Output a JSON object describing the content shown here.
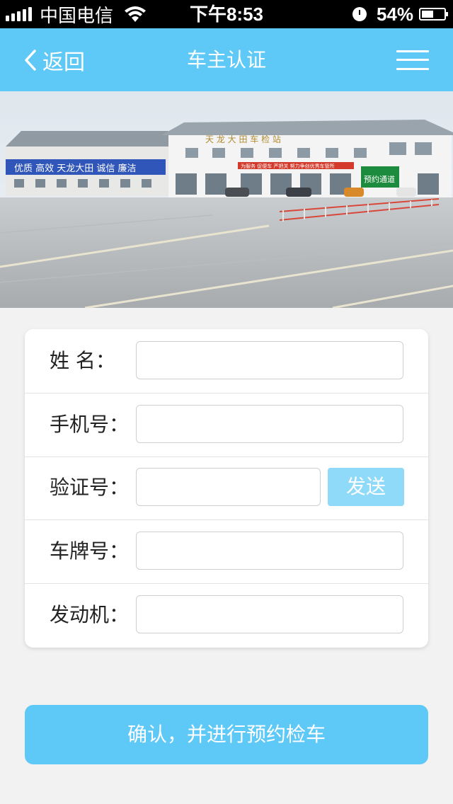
{
  "status_bar": {
    "carrier": "中国电信",
    "time": "下午8:53",
    "battery_percent": "54%",
    "battery_level": 0.54,
    "icons": [
      "signal-icon",
      "wifi-icon",
      "clock-icon",
      "battery-icon"
    ]
  },
  "nav": {
    "back_label": "返回",
    "title": "车主认证",
    "menu_icon": "hamburger-menu-icon"
  },
  "banner": {
    "sign_left": "优质  高效  天龙大田  诚信  廉洁",
    "sign_red": "为服务 促便车 严把关 努力争创优秀车管所",
    "roof_text": "天 龙 大 田 车 检 站",
    "sign_green": "预约通道"
  },
  "form": {
    "name_label": "姓  名：",
    "phone_label": "手机号：",
    "code_label": "验证号：",
    "send_label": "发送",
    "plate_label": "车牌号：",
    "engine_label": "发动机："
  },
  "confirm_label": "确认，并进行预约检车",
  "colors": {
    "primary": "#5ec8f7",
    "send_button": "#8fd9f9",
    "background": "#f2f2f2"
  }
}
